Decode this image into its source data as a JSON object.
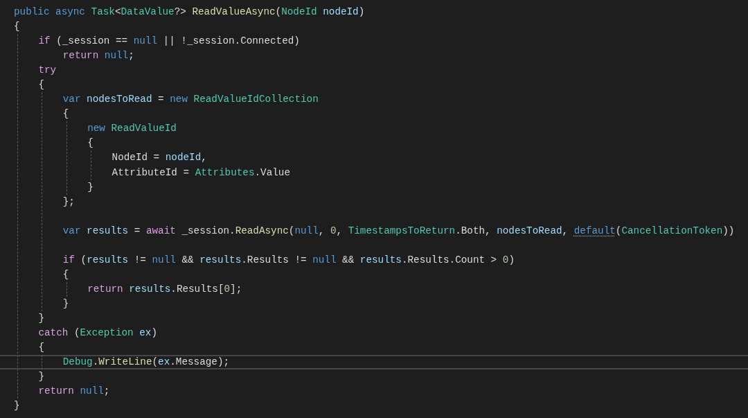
{
  "editor": {
    "lines": [
      {
        "kind": "line",
        "current": false,
        "tokens": [
          {
            "kind": "keyword",
            "text": "public async "
          },
          {
            "kind": "type",
            "text": "Task"
          },
          {
            "kind": "plain",
            "text": "<"
          },
          {
            "kind": "type",
            "text": "DataValue"
          },
          {
            "kind": "plain",
            "text": "?> "
          },
          {
            "kind": "method",
            "text": "ReadValueAsync"
          },
          {
            "kind": "plain",
            "text": "("
          },
          {
            "kind": "type",
            "text": "NodeId"
          },
          {
            "kind": "variable",
            "text": " nodeId"
          },
          {
            "kind": "plain",
            "text": ")"
          }
        ]
      },
      {
        "kind": "line",
        "current": false,
        "tokens": [
          {
            "kind": "plain",
            "text": "{"
          }
        ]
      },
      {
        "kind": "block",
        "guide": true,
        "children": [
          {
            "kind": "line",
            "current": false,
            "tokens": [
              {
                "kind": "control",
                "text": "if"
              },
              {
                "kind": "plain",
                "text": " (_session == "
              },
              {
                "kind": "keyword",
                "text": "null"
              },
              {
                "kind": "plain",
                "text": " || !_session.Connected)"
              }
            ]
          },
          {
            "kind": "block",
            "guide": false,
            "children": [
              {
                "kind": "line",
                "current": false,
                "tokens": [
                  {
                    "kind": "control",
                    "text": "return"
                  },
                  {
                    "kind": "keyword",
                    "text": " null"
                  },
                  {
                    "kind": "plain",
                    "text": ";"
                  }
                ]
              }
            ]
          },
          {
            "kind": "line",
            "current": false,
            "tokens": [
              {
                "kind": "control",
                "text": "try"
              }
            ]
          },
          {
            "kind": "line",
            "current": false,
            "tokens": [
              {
                "kind": "plain",
                "text": "{"
              }
            ]
          },
          {
            "kind": "block",
            "guide": true,
            "children": [
              {
                "kind": "line",
                "current": false,
                "tokens": [
                  {
                    "kind": "keyword",
                    "text": "var"
                  },
                  {
                    "kind": "variable",
                    "text": " nodesToRead"
                  },
                  {
                    "kind": "plain",
                    "text": " = "
                  },
                  {
                    "kind": "keyword",
                    "text": "new"
                  },
                  {
                    "kind": "type",
                    "text": " ReadValueIdCollection"
                  }
                ]
              },
              {
                "kind": "line",
                "current": false,
                "tokens": [
                  {
                    "kind": "plain",
                    "text": "{"
                  }
                ]
              },
              {
                "kind": "block",
                "guide": true,
                "children": [
                  {
                    "kind": "line",
                    "current": false,
                    "tokens": [
                      {
                        "kind": "keyword",
                        "text": "new"
                      },
                      {
                        "kind": "type",
                        "text": " ReadValueId"
                      }
                    ]
                  },
                  {
                    "kind": "line",
                    "current": false,
                    "tokens": [
                      {
                        "kind": "plain",
                        "text": "{"
                      }
                    ]
                  },
                  {
                    "kind": "block",
                    "guide": true,
                    "children": [
                      {
                        "kind": "line",
                        "current": false,
                        "tokens": [
                          {
                            "kind": "plain",
                            "text": "NodeId = "
                          },
                          {
                            "kind": "variable",
                            "text": "nodeId"
                          },
                          {
                            "kind": "plain",
                            "text": ","
                          }
                        ]
                      },
                      {
                        "kind": "line",
                        "current": false,
                        "tokens": [
                          {
                            "kind": "plain",
                            "text": "AttributeId = "
                          },
                          {
                            "kind": "type",
                            "text": "Attributes"
                          },
                          {
                            "kind": "plain",
                            "text": ".Value"
                          }
                        ]
                      }
                    ]
                  },
                  {
                    "kind": "line",
                    "current": false,
                    "tokens": [
                      {
                        "kind": "plain",
                        "text": "}"
                      }
                    ]
                  }
                ]
              },
              {
                "kind": "line",
                "current": false,
                "tokens": [
                  {
                    "kind": "plain",
                    "text": "};"
                  }
                ]
              },
              {
                "kind": "blank"
              },
              {
                "kind": "line",
                "current": false,
                "tokens": [
                  {
                    "kind": "keyword",
                    "text": "var"
                  },
                  {
                    "kind": "variable",
                    "text": " results"
                  },
                  {
                    "kind": "plain",
                    "text": " = "
                  },
                  {
                    "kind": "control",
                    "text": "await"
                  },
                  {
                    "kind": "plain",
                    "text": " _session."
                  },
                  {
                    "kind": "method",
                    "text": "ReadAsync"
                  },
                  {
                    "kind": "plain",
                    "text": "("
                  },
                  {
                    "kind": "keyword",
                    "text": "null"
                  },
                  {
                    "kind": "plain",
                    "text": ", "
                  },
                  {
                    "kind": "number",
                    "text": "0"
                  },
                  {
                    "kind": "plain",
                    "text": ", "
                  },
                  {
                    "kind": "type",
                    "text": "TimestampsToReturn"
                  },
                  {
                    "kind": "plain",
                    "text": ".Both, "
                  },
                  {
                    "kind": "variable",
                    "text": "nodesToRead"
                  },
                  {
                    "kind": "plain",
                    "text": ", "
                  },
                  {
                    "kind": "hinted-keyword",
                    "text": "default"
                  },
                  {
                    "kind": "plain",
                    "text": "("
                  },
                  {
                    "kind": "type",
                    "text": "CancellationToken"
                  },
                  {
                    "kind": "plain",
                    "text": "))"
                  }
                ]
              },
              {
                "kind": "blank"
              },
              {
                "kind": "line",
                "current": false,
                "tokens": [
                  {
                    "kind": "control",
                    "text": "if"
                  },
                  {
                    "kind": "plain",
                    "text": " ("
                  },
                  {
                    "kind": "variable",
                    "text": "results"
                  },
                  {
                    "kind": "plain",
                    "text": " != "
                  },
                  {
                    "kind": "keyword",
                    "text": "null"
                  },
                  {
                    "kind": "plain",
                    "text": " && "
                  },
                  {
                    "kind": "variable",
                    "text": "results"
                  },
                  {
                    "kind": "plain",
                    "text": ".Results != "
                  },
                  {
                    "kind": "keyword",
                    "text": "null"
                  },
                  {
                    "kind": "plain",
                    "text": " && "
                  },
                  {
                    "kind": "variable",
                    "text": "results"
                  },
                  {
                    "kind": "plain",
                    "text": ".Results.Count > "
                  },
                  {
                    "kind": "number",
                    "text": "0"
                  },
                  {
                    "kind": "plain",
                    "text": ")"
                  }
                ]
              },
              {
                "kind": "line",
                "current": false,
                "tokens": [
                  {
                    "kind": "plain",
                    "text": "{"
                  }
                ]
              },
              {
                "kind": "block",
                "guide": true,
                "children": [
                  {
                    "kind": "line",
                    "current": false,
                    "tokens": [
                      {
                        "kind": "control",
                        "text": "return"
                      },
                      {
                        "kind": "variable",
                        "text": " results"
                      },
                      {
                        "kind": "plain",
                        "text": ".Results["
                      },
                      {
                        "kind": "number",
                        "text": "0"
                      },
                      {
                        "kind": "plain",
                        "text": "];"
                      }
                    ]
                  }
                ]
              },
              {
                "kind": "line",
                "current": false,
                "tokens": [
                  {
                    "kind": "plain",
                    "text": "}"
                  }
                ]
              }
            ]
          },
          {
            "kind": "line",
            "current": false,
            "tokens": [
              {
                "kind": "plain",
                "text": "}"
              }
            ]
          },
          {
            "kind": "line",
            "current": false,
            "tokens": [
              {
                "kind": "control",
                "text": "catch"
              },
              {
                "kind": "plain",
                "text": " ("
              },
              {
                "kind": "type",
                "text": "Exception"
              },
              {
                "kind": "variable",
                "text": " ex"
              },
              {
                "kind": "plain",
                "text": ")"
              }
            ]
          },
          {
            "kind": "line",
            "current": false,
            "tokens": [
              {
                "kind": "plain",
                "text": "{"
              }
            ]
          },
          {
            "kind": "block",
            "guide": true,
            "children": [
              {
                "kind": "line",
                "current": true,
                "tokens": [
                  {
                    "kind": "type",
                    "text": "Debug"
                  },
                  {
                    "kind": "plain",
                    "text": "."
                  },
                  {
                    "kind": "method",
                    "text": "WriteLine"
                  },
                  {
                    "kind": "plain",
                    "text": "("
                  },
                  {
                    "kind": "variable",
                    "text": "ex"
                  },
                  {
                    "kind": "plain",
                    "text": ".Message);"
                  }
                ]
              }
            ]
          },
          {
            "kind": "line",
            "current": false,
            "tokens": [
              {
                "kind": "plain",
                "text": "}"
              }
            ]
          },
          {
            "kind": "line",
            "current": false,
            "tokens": [
              {
                "kind": "control",
                "text": "return"
              },
              {
                "kind": "keyword",
                "text": " null"
              },
              {
                "kind": "plain",
                "text": ";"
              }
            ]
          }
        ]
      },
      {
        "kind": "line",
        "current": false,
        "tokens": [
          {
            "kind": "plain",
            "text": "}"
          }
        ]
      }
    ]
  }
}
